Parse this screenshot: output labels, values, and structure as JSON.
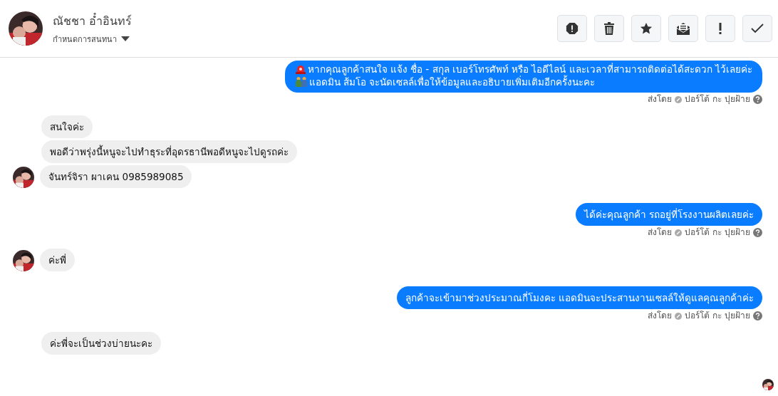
{
  "header": {
    "name": "ณัชชา อ๋ำอินทร์",
    "subtitle": "กำหนดการสนทนา"
  },
  "messages": [
    {
      "kind": "outgoing",
      "lines": [
        "หากคุณลูกค้าสนใจ แจ้ง ชื่อ - สกุล เบอร์โทรศัพท์ หรือ ไอดีไลน์ และเวลาที่สามารถติดต่อได้สะดวก ไว้เลยค่ะ",
        "แอดมิน ส้มโอ จะนัดเซลล์เพื่อให้ข้อมูลและอธิบายเพิ่มเติมอีกครั้งนะคะ"
      ],
      "sent_label": "ส่งโดย",
      "sender": "ปอร์โต้ กะ ปุยฝ้าย"
    },
    {
      "kind": "incoming",
      "lines": [
        "สนใจค่ะ"
      ],
      "avatar": false
    },
    {
      "kind": "incoming",
      "lines": [
        "พอดีว่าพรุ่งนี้หนูจะไปทำธุระที่อุดรธานีพอดีหนูจะไปดูรถค่ะ"
      ],
      "avatar": false
    },
    {
      "kind": "incoming",
      "lines": [
        "จันทร์จิรา  ผาเคน  0985989085"
      ],
      "avatar": true
    },
    {
      "kind": "outgoing",
      "lines": [
        "ได้ค่ะคุณลูกค้า รถอยู่ที่โรงงานผลิตเลยค่ะ"
      ],
      "sent_label": "ส่งโดย",
      "sender": "ปอร์โต้ กะ ปุยฝ้าย"
    },
    {
      "kind": "incoming",
      "lines": [
        "ค่ะพี่"
      ],
      "avatar": true
    },
    {
      "kind": "outgoing",
      "lines": [
        "ลูกค้าจะเข้ามาช่วงประมาณกี่โมงคะ แอดมินจะประสานงานเซลล์ให้ดูแลคุณลูกค้าค่ะ"
      ],
      "sent_label": "ส่งโดย",
      "sender": "ปอร์โต้ กะ ปุยฝ้าย"
    },
    {
      "kind": "incoming",
      "lines": [
        "ค่ะพี่จะเป็นช่วงบ่ายนะคะ"
      ],
      "avatar": false
    }
  ]
}
